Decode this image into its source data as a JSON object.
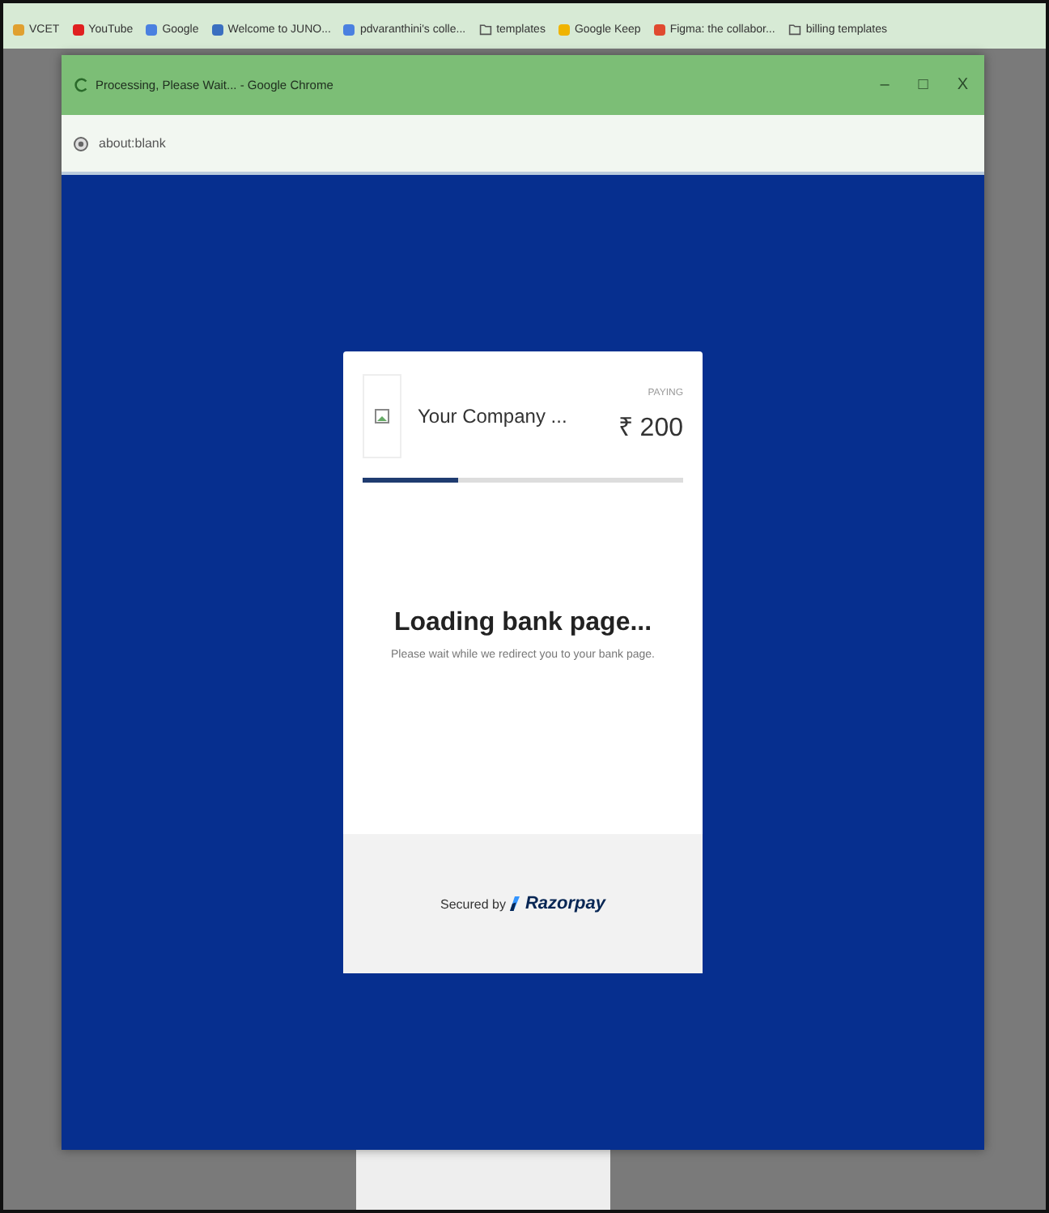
{
  "bookmarks": [
    {
      "label": "VCET",
      "kind": "site",
      "color": "#e0a030"
    },
    {
      "label": "YouTube",
      "kind": "site",
      "color": "#e02020"
    },
    {
      "label": "Google",
      "kind": "site",
      "color": "#4a80e0"
    },
    {
      "label": "Welcome to JUNO...",
      "kind": "site",
      "color": "#3a6fc0"
    },
    {
      "label": "pdvaranthini's colle...",
      "kind": "site",
      "color": "#4a80e0"
    },
    {
      "label": "templates",
      "kind": "folder"
    },
    {
      "label": "Google Keep",
      "kind": "site",
      "color": "#f0b400"
    },
    {
      "label": "Figma: the collabor...",
      "kind": "site",
      "color": "#e04a30"
    },
    {
      "label": "billing templates",
      "kind": "folder"
    }
  ],
  "window": {
    "title": "Processing, Please Wait... - Google Chrome",
    "address": "about:blank",
    "controls": [
      "–",
      "□",
      "X"
    ]
  },
  "card": {
    "merchant": "Your Company ...",
    "paying_label": "PAYING",
    "amount": "₹ 200",
    "progress": {
      "level": 0.3
    },
    "heading": "Loading bank page...",
    "message": "Please wait while we redirect you to your bank page.",
    "secured_by": "Secured by",
    "brand": "Razorpay"
  }
}
